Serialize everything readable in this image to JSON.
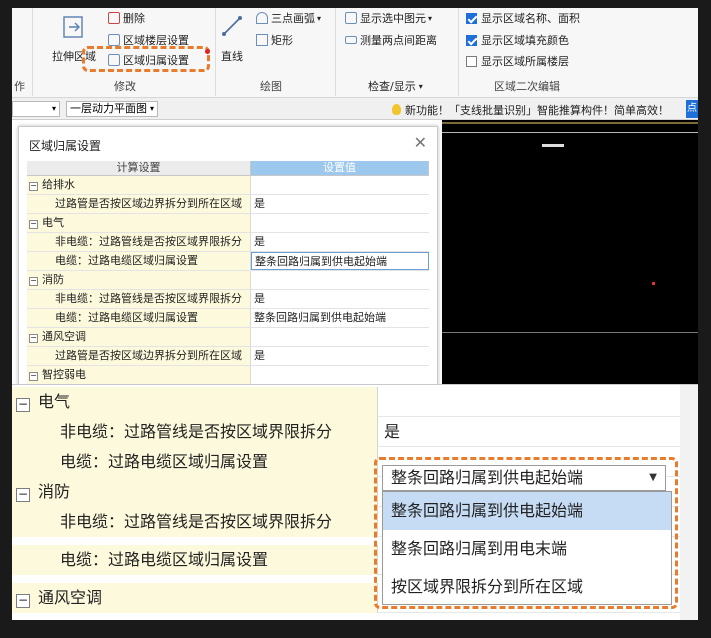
{
  "ribbon": {
    "modify": {
      "stretch_label": "拉伸区域",
      "delete_label": "删除",
      "region_floor_label": "区域楼层设置",
      "region_owner_label": "区域归属设置",
      "group_label": "修改"
    },
    "left_group_label": "作",
    "draw": {
      "line_label": "直线",
      "arc_label": "三点画弧",
      "rect_label": "矩形",
      "group_label": "绘图"
    },
    "check": {
      "show_selected_label": "显示选中图元",
      "measure_label": "测量两点间距离",
      "group_label": "检查/显示"
    },
    "region2": {
      "show_name_area_label": "显示区域名称、面积",
      "show_fill_label": "显示区域填充颜色",
      "show_floor_label": "显示区域所属楼层",
      "show_name_area_checked": true,
      "show_fill_checked": true,
      "show_floor_checked": false,
      "group_label": "区域二次编辑"
    }
  },
  "toolbar": {
    "floor_combo": "一层动力平面图",
    "notice_text": "新功能！「支线批量识别」智能推算构件！简单高效！",
    "notice_btn": "点"
  },
  "dialog": {
    "title": "区域归属设置",
    "col_setting": "计算设置",
    "col_value": "设置值",
    "rows": [
      {
        "kind": "cat",
        "label": "给排水",
        "value": ""
      },
      {
        "kind": "sub",
        "label": "过路管是否按区域边界拆分到所在区域",
        "value": "是"
      },
      {
        "kind": "cat",
        "label": "电气",
        "value": ""
      },
      {
        "kind": "sub",
        "label": "非电缆：过路管线是否按区域界限拆分",
        "value": "是"
      },
      {
        "kind": "sub",
        "label": "电缆：过路电缆区域归属设置",
        "value": "整条回路归属到供电起始端",
        "selected": true
      },
      {
        "kind": "cat",
        "label": "消防",
        "value": ""
      },
      {
        "kind": "sub",
        "label": "非电缆：过路管线是否按区域界限拆分",
        "value": "是"
      },
      {
        "kind": "sub",
        "label": "电缆：过路电缆区域归属设置",
        "value": "整条回路归属到供电起始端"
      },
      {
        "kind": "cat",
        "label": "通风空调",
        "value": ""
      },
      {
        "kind": "sub",
        "label": "过路管是否按区域边界拆分到所在区域",
        "value": "是"
      },
      {
        "kind": "cat",
        "label": "智控弱电",
        "value": ""
      }
    ]
  },
  "zoom": {
    "cat_electric": "电气",
    "row_noncable_label": "非电缆：过路管线是否按区域界限拆分",
    "row_noncable_value": "是",
    "row_cable_label": "电缆：过路电缆区域归属设置",
    "row_cable_value": "整条回路归属到供电起始端",
    "cat_fire": "消防",
    "row2_noncable_label": "非电缆：过路管线是否按区域界限拆分",
    "row2_cable_label": "电缆：过路电缆区域归属设置",
    "cat_hvac": "通风空调",
    "options": [
      "整条回路归属到供电起始端",
      "整条回路归属到用电末端",
      "按区域界限拆分到所在区域"
    ],
    "highlight_index": 0
  },
  "colors": {
    "dash_orange": "#e87b2c",
    "header_blue": "#9cc8ee",
    "cell_yellow": "#fdf9dc",
    "option_highlight": "#c6dcf5"
  }
}
